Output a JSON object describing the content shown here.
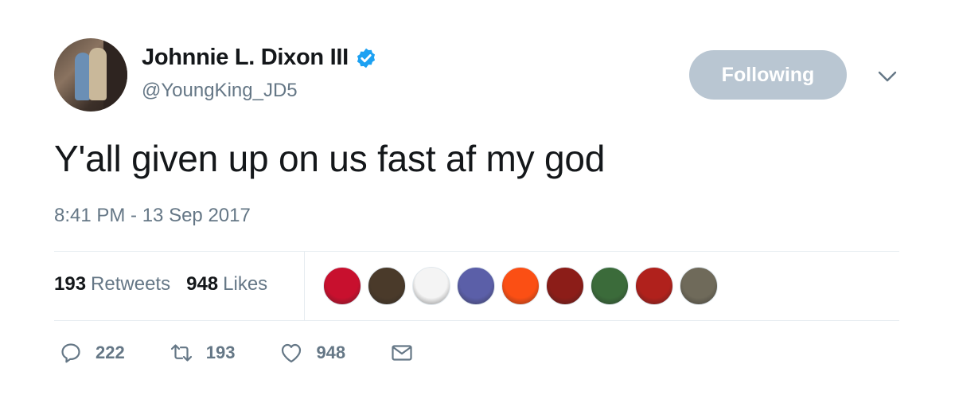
{
  "author": {
    "display_name": "Johnnie L. Dixon III",
    "handle": "@YoungKing_JD5",
    "verified": true
  },
  "follow_button": {
    "label": "Following"
  },
  "tweet": {
    "text": "Y'all given up on us fast af my god",
    "timestamp": "8:41 PM - 13 Sep 2017"
  },
  "stats": {
    "retweets_count": "193",
    "retweets_label": "Retweets",
    "likes_count": "948",
    "likes_label": "Likes"
  },
  "likers": [
    {
      "name": "liker-buckeye-avatar",
      "color": "#c8102e"
    },
    {
      "name": "liker-browns-avatar",
      "color": "#4a3a2a"
    },
    {
      "name": "liker-bh-avatar",
      "color": "#f4f4f4"
    },
    {
      "name": "liker-stars-avatar",
      "color": "#5b5fa8"
    },
    {
      "name": "liker-broncos-avatar",
      "color": "#fb4f14"
    },
    {
      "name": "liker-player-red-avatar",
      "color": "#8c1d18"
    },
    {
      "name": "liker-player-green-avatar",
      "color": "#3b6b3a"
    },
    {
      "name": "liker-player-scarlet-avatar",
      "color": "#b0211c"
    },
    {
      "name": "liker-player-outdoor-avatar",
      "color": "#6f6a5a"
    }
  ],
  "actions": {
    "reply_count": "222",
    "retweet_count": "193",
    "like_count": "948"
  },
  "colors": {
    "verified_blue": "#1da1f2",
    "secondary_text": "#657786",
    "divider": "#e6ecf0",
    "following_button_bg": "#b9c6d2"
  },
  "icons": {
    "verified": "verified-badge-icon",
    "caret": "chevron-down-icon",
    "reply": "reply-icon",
    "retweet": "retweet-icon",
    "like": "heart-icon",
    "message": "envelope-icon"
  }
}
